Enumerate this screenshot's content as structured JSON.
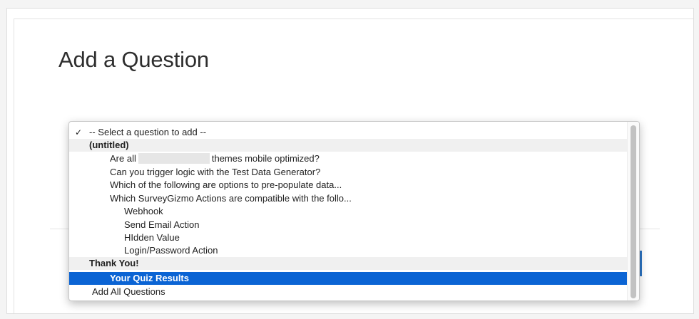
{
  "page": {
    "title": "Add a Question"
  },
  "dropdown": {
    "checkmark": "✓",
    "options": [
      {
        "label": "-- Select a question to add --",
        "type": "placeholder",
        "checked": true
      },
      {
        "label": "(untitled)",
        "type": "group"
      },
      {
        "label_before": "Are all",
        "label_after": "themes mobile optimized?",
        "type": "question",
        "redacted": true
      },
      {
        "label": "Can you trigger logic with the Test Data Generator?",
        "type": "question"
      },
      {
        "label": "Which of the following are options to pre-populate data...",
        "type": "question"
      },
      {
        "label": "Which SurveyGizmo Actions are compatible with the follo...",
        "type": "question"
      },
      {
        "label": "Webhook",
        "type": "sub-option"
      },
      {
        "label": "Send Email Action",
        "type": "sub-option"
      },
      {
        "label": "HIdden Value",
        "type": "sub-option"
      },
      {
        "label": "Login/Password Action",
        "type": "sub-option"
      },
      {
        "label": "Thank You!",
        "type": "group"
      },
      {
        "label": "Your Quiz Results",
        "type": "question",
        "selected": true
      },
      {
        "label": "Add All Questions",
        "type": "action"
      }
    ]
  },
  "colors": {
    "selection": "#0b64d4",
    "group_background": "#f0f0f0",
    "accent_edge": "#2d74c4"
  }
}
